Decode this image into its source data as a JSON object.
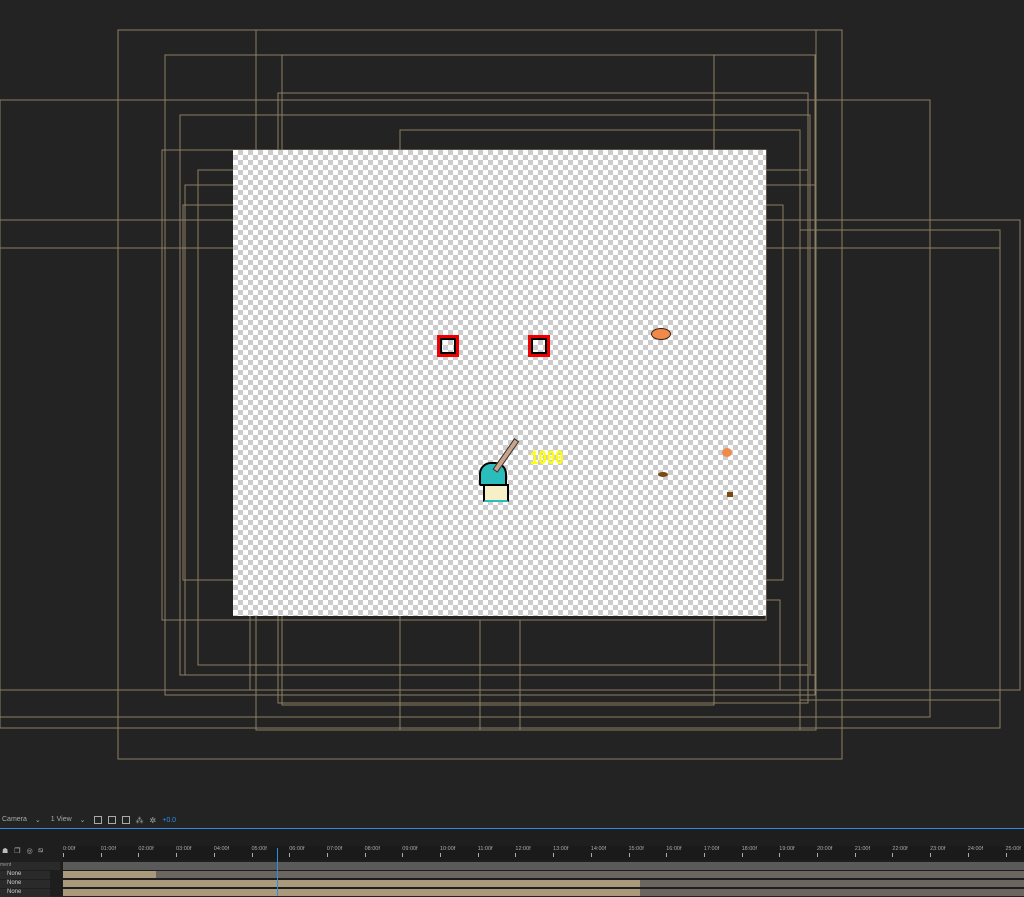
{
  "viewer": {
    "score_text": "1000"
  },
  "toolbar": {
    "camera": "Camera",
    "view": "1 View",
    "exposure": "+0.0"
  },
  "timeline": {
    "ticks": [
      "0:00f",
      "01:00f",
      "02:00f",
      "03:00f",
      "04:00f",
      "05:00f",
      "06:00f",
      "07:00f",
      "08:00f",
      "09:00f",
      "10:00f",
      "11:00f",
      "12:00f",
      "13:00f",
      "14:00f",
      "15:00f",
      "16:00f",
      "17:00f",
      "18:00f",
      "19:00f",
      "20:00f",
      "21:00f",
      "22:00f",
      "23:00f",
      "24:00f",
      "25:00f"
    ],
    "column_header": "ment",
    "layers": [
      {
        "parent": "None"
      },
      {
        "parent": "None"
      },
      {
        "parent": "None"
      }
    ]
  }
}
